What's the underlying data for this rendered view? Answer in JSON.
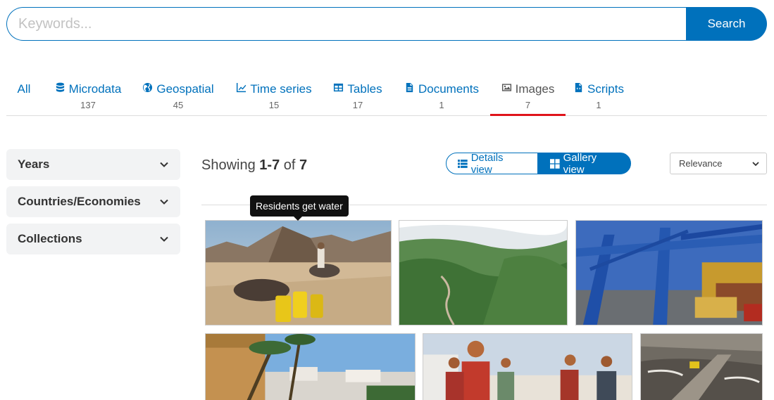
{
  "search": {
    "placeholder": "Keywords...",
    "button_label": "Search"
  },
  "tabs": [
    {
      "label": "All",
      "count": "",
      "icon": "none"
    },
    {
      "label": "Microdata",
      "count": "137",
      "icon": "database-icon"
    },
    {
      "label": "Geospatial",
      "count": "45",
      "icon": "globe-icon"
    },
    {
      "label": "Time series",
      "count": "15",
      "icon": "line-chart-icon"
    },
    {
      "label": "Tables",
      "count": "17",
      "icon": "table-icon"
    },
    {
      "label": "Documents",
      "count": "1",
      "icon": "document-icon"
    },
    {
      "label": "Images",
      "count": "7",
      "icon": "image-icon",
      "active": true
    },
    {
      "label": "Scripts",
      "count": "1",
      "icon": "code-file-icon"
    }
  ],
  "facets": [
    {
      "label": "Years"
    },
    {
      "label": "Countries/Economies"
    },
    {
      "label": "Collections"
    }
  ],
  "results": {
    "showing_prefix": "Showing",
    "range": "1-7",
    "of_word": "of",
    "total": "7"
  },
  "view_toggle": {
    "details_label": "Details view",
    "gallery_label": "Gallery view",
    "active": "gallery"
  },
  "sort": {
    "selected": "Relevance"
  },
  "tooltip": {
    "text": "Residents get water"
  },
  "gallery": [
    {
      "subject": "donkeys with water containers in desert"
    },
    {
      "subject": "green mountains with winding road"
    },
    {
      "subject": "port container cranes"
    },
    {
      "subject": "palm trees and city"
    },
    {
      "subject": "women carrying water pots"
    },
    {
      "subject": "mining site with truck"
    }
  ],
  "colors": {
    "accent": "#0071bc",
    "active_tab_underline": "#e0141b"
  }
}
